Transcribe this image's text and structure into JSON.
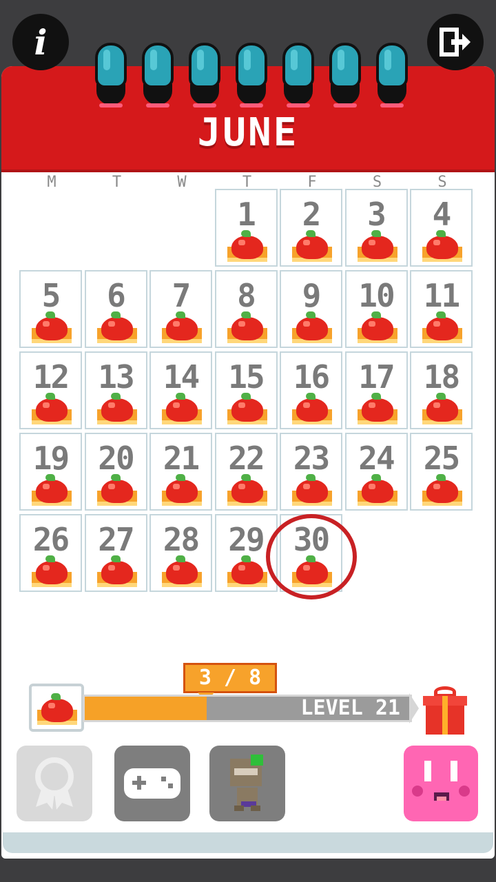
{
  "calendar": {
    "month": "JUNE",
    "weekdays": [
      "M",
      "T",
      "W",
      "T",
      "F",
      "S",
      "S"
    ],
    "days": [
      "1",
      "2",
      "3",
      "4",
      "5",
      "6",
      "7",
      "8",
      "9",
      "10",
      "11",
      "12",
      "13",
      "14",
      "15",
      "16",
      "17",
      "18",
      "19",
      "20",
      "21",
      "22",
      "23",
      "24",
      "25",
      "26",
      "27",
      "28",
      "29",
      "30"
    ],
    "today": "30"
  },
  "progress": {
    "count_label": "3 / 8",
    "fraction": 0.375,
    "level_label": "LEVEL 21"
  },
  "colors": {
    "header_red": "#d5191b",
    "progress_orange": "#f6a127",
    "ring_teal": "#2aa3b6",
    "pink_face": "#ff66b3"
  },
  "icons": {
    "info": "info-icon",
    "exit": "exit-icon",
    "achievements": "ribbon-icon",
    "games": "gamepad-icon",
    "character": "character-icon",
    "pink": "pink-face-icon",
    "gift": "gift-icon"
  }
}
